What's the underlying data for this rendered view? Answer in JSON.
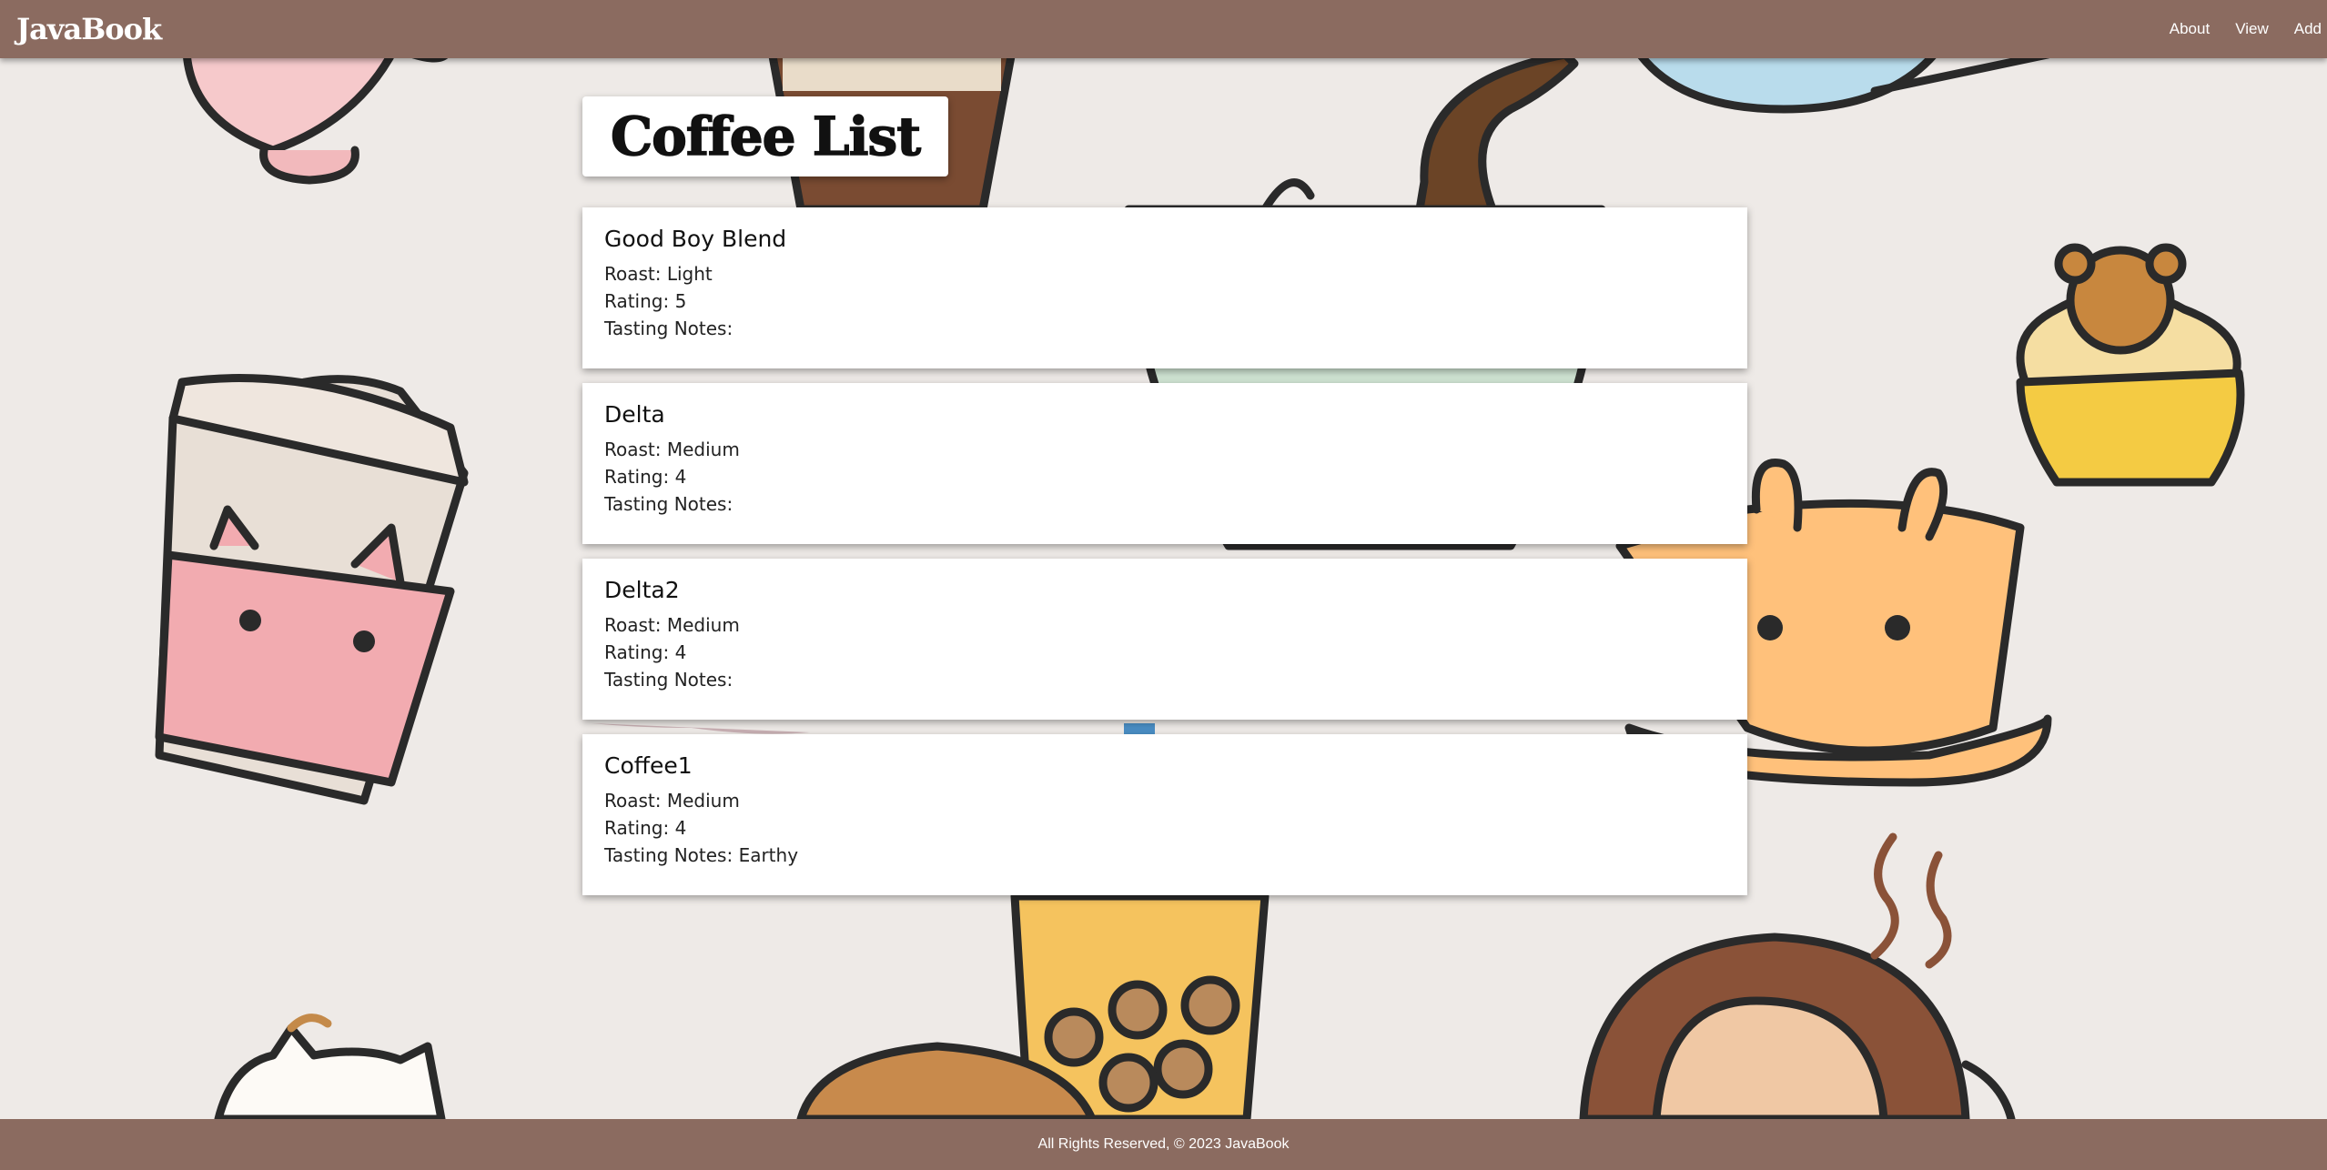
{
  "header": {
    "brand": "JavaBook",
    "nav": [
      {
        "label": "About"
      },
      {
        "label": "View"
      },
      {
        "label": "Add"
      }
    ]
  },
  "main": {
    "title": "Coffee List",
    "coffees": [
      {
        "name": "Good Boy Blend",
        "roast": "Roast: Light",
        "rating": "Rating: 5",
        "notes": "Tasting Notes:"
      },
      {
        "name": "Delta",
        "roast": "Roast: Medium",
        "rating": "Rating: 4",
        "notes": "Tasting Notes:"
      },
      {
        "name": "Delta2",
        "roast": "Roast: Medium",
        "rating": "Rating: 4",
        "notes": "Tasting Notes:"
      },
      {
        "name": "Coffee1",
        "roast": "Roast: Medium",
        "rating": "Rating: 4",
        "notes": "Tasting Notes: Earthy"
      }
    ]
  },
  "footer": {
    "text": "All Rights Reserved, © 2023 JavaBook"
  },
  "colors": {
    "header_bg": "#8b6b60",
    "page_bg": "#eeeae7",
    "card_bg": "#ffffff"
  },
  "icons": {
    "background": "coffee-cats-illustration"
  }
}
